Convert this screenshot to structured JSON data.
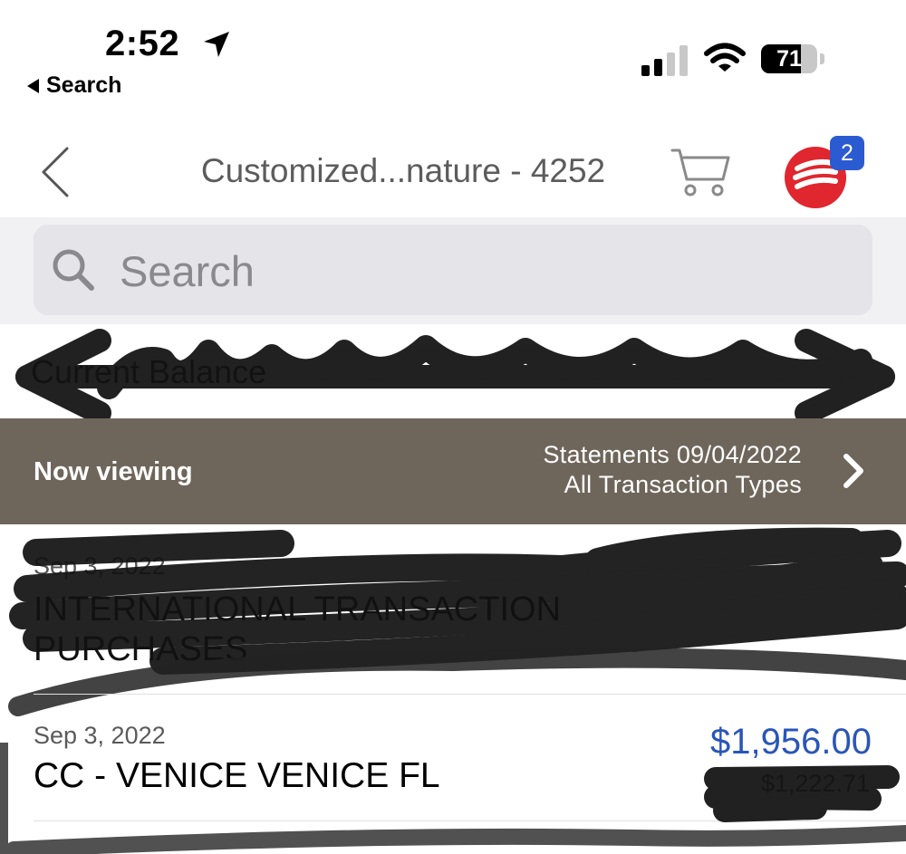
{
  "status_bar": {
    "time": "2:52",
    "back_label": "Search",
    "battery_percent": "71",
    "battery_level": 0.71,
    "icons": [
      "location-arrow-icon",
      "cellular-signal-icon",
      "wifi-icon",
      "battery-icon"
    ]
  },
  "nav": {
    "title": "Customized...nature - 4252",
    "icons": [
      "back-chevron-icon",
      "cart-icon",
      "messages-icon"
    ],
    "messages_badge": "2",
    "brand_color": "#e0262e",
    "badge_color": "#2b5bd1"
  },
  "search": {
    "placeholder": "Search"
  },
  "balance": {
    "label": "Current Balance",
    "value": ""
  },
  "viewing_bar": {
    "label": "Now viewing",
    "line1": "Statements 09/04/2022",
    "line2": "All Transaction Types",
    "background": "#6f665b"
  },
  "transactions": [
    {
      "date": "Sep 3, 2022",
      "description_line1": "INTERNATIONAL TRANSACTION",
      "description_line2": "PURCHASES",
      "amount": "",
      "balance": ""
    },
    {
      "date": "Sep 3, 2022",
      "description_line1": "CC - VENICE VENICE FL",
      "amount": "$1,956.00",
      "balance": "$1,222.71"
    }
  ],
  "colors": {
    "amount": "#2a55b8"
  }
}
